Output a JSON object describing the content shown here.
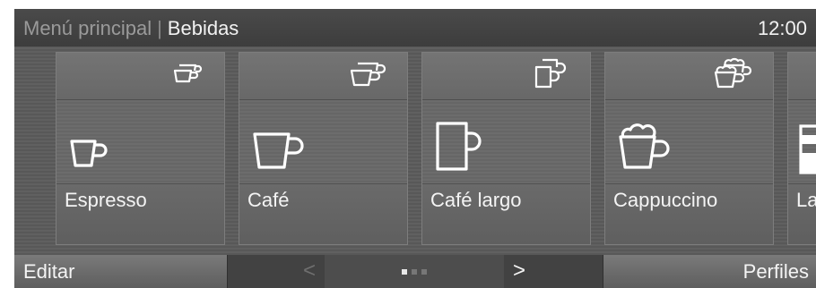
{
  "header": {
    "crumb_parent": "Menú principal",
    "crumb_separator": "|",
    "crumb_current": "Bebidas",
    "clock": "12:00"
  },
  "tiles": [
    {
      "label": "Espresso",
      "size_icon": "small-cup-icon",
      "cup_icon": "espresso-cup-icon"
    },
    {
      "label": "Café",
      "size_icon": "medium-cup-icon",
      "cup_icon": "coffee-cup-icon"
    },
    {
      "label": "Café largo",
      "size_icon": "tall-mug-icon",
      "cup_icon": "mug-icon"
    },
    {
      "label": "Cappuccino",
      "size_icon": "foam-cup-icon",
      "cup_icon": "cappuccino-cup-icon"
    },
    {
      "label": "La",
      "size_icon": "",
      "cup_icon": "glass-icon"
    }
  ],
  "footer": {
    "edit_label": "Editar",
    "prev_label": "<",
    "next_label": ">",
    "profiles_label": "Perfiles",
    "page_count": 3,
    "current_page": 1
  },
  "colors": {
    "background": "#5b5b5b",
    "active_dot": "#e8e8e8",
    "inactive_dot": "#777777"
  }
}
